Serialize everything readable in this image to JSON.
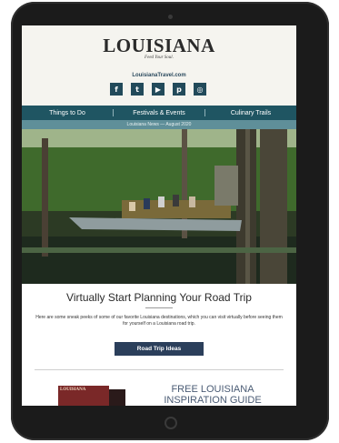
{
  "header": {
    "logo": "LOUISIANA",
    "tagline": "Feed Your Soul.",
    "site": "LouisianaTravel.com"
  },
  "social": [
    {
      "icon": "facebook-icon",
      "glyph": "f"
    },
    {
      "icon": "twitter-icon",
      "glyph": "t"
    },
    {
      "icon": "youtube-icon",
      "glyph": "▶"
    },
    {
      "icon": "pinterest-icon",
      "glyph": "p"
    },
    {
      "icon": "instagram-icon",
      "glyph": "◎"
    }
  ],
  "nav": {
    "items": [
      {
        "label": "Things to Do"
      },
      {
        "label": "Festivals & Events"
      },
      {
        "label": "Culinary Trails"
      }
    ]
  },
  "issue_bar": "Louisiana News — August 2020",
  "hero": {
    "alt": "Airboat tour in a cypress swamp"
  },
  "main": {
    "title": "Virtually Start Planning Your Road Trip",
    "body": "Here are some sneak peeks of some of our favorite Louisiana destinations, which you can visit virtually before seeing them for yourself on a Louisiana road trip.",
    "button_label": "Road Trip Ideas"
  },
  "guide": {
    "cover_text": "LOUISIANA",
    "title": "FREE LOUISIANA INSPIRATION GUIDE"
  },
  "colors": {
    "nav_bg": "#1f5562",
    "issue_bg": "#5f8f99",
    "button_bg": "#2b3f5b",
    "social_bg": "#224a5a"
  }
}
